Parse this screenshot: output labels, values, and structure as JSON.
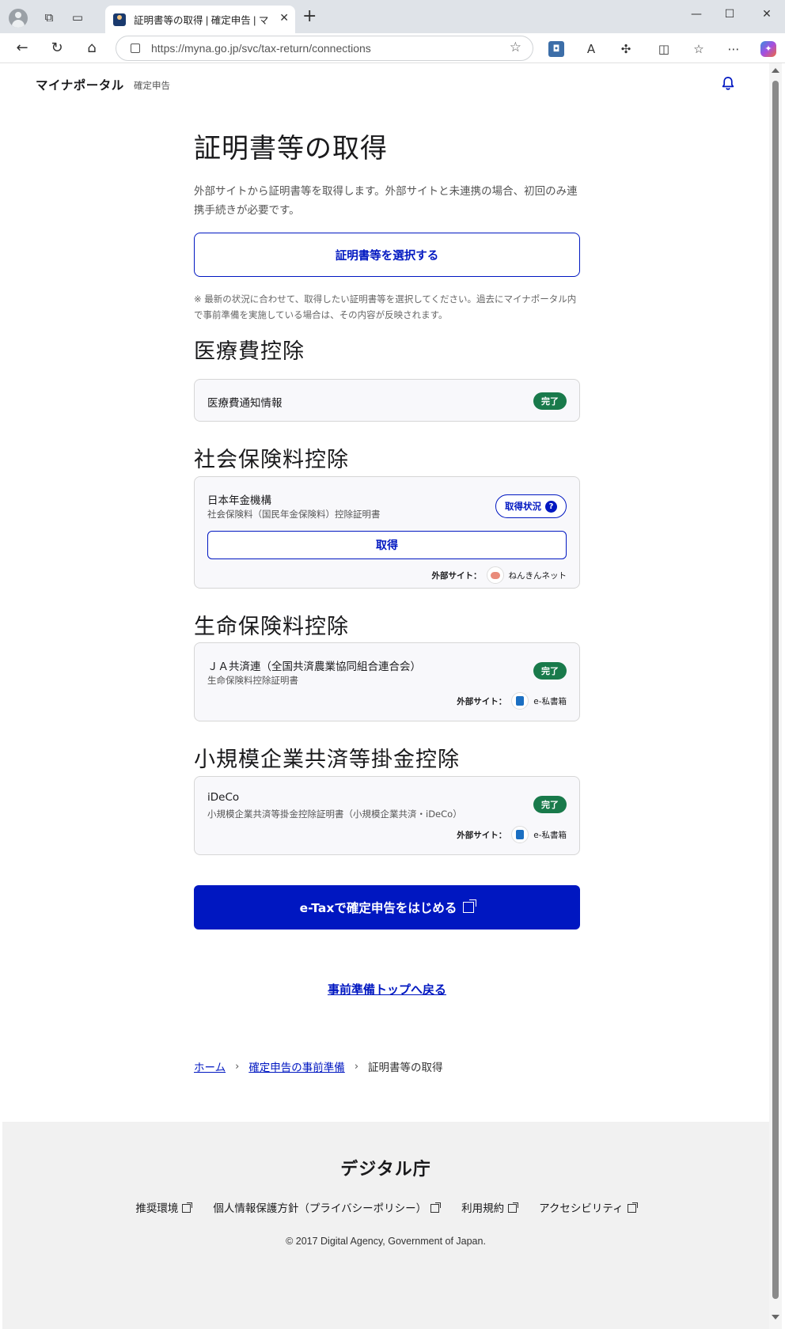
{
  "browser": {
    "tab_title": "証明書等の取得 | 確定申告 | マ",
    "url": "https://myna.go.jp/svc/tax-return/connections"
  },
  "header": {
    "brand": "マイナポータル",
    "sub": "確定申告"
  },
  "page": {
    "title": "証明書等の取得",
    "lead": "外部サイトから証明書等を取得します。外部サイトと未連携の場合、初回のみ連携手続きが必要です。",
    "select_button": "証明書等を選択する",
    "note": "※ 最新の状況に合わせて、取得したい証明書等を選択してください。過去にマイナポータル内で事前準備を実施している場合は、その内容が反映されます。"
  },
  "sections": [
    {
      "heading": "医療費控除",
      "card": {
        "title": "医療費通知情報",
        "badge": "完了"
      }
    },
    {
      "heading": "社会保険料控除",
      "card": {
        "title": "日本年金機構",
        "subtitle": "社会保険料（国民年金保険料）控除証明書",
        "status_button": "取得状況",
        "get_button": "取得",
        "external_label": "外部サイト：",
        "external_site": "ねんきんネット"
      }
    },
    {
      "heading": "生命保険料控除",
      "card": {
        "title": "ＪＡ共済連（全国共済農業協同組合連合会）",
        "subtitle": "生命保険料控除証明書",
        "badge": "完了",
        "external_label": "外部サイト：",
        "external_site": "e-私書箱"
      }
    },
    {
      "heading": "小規模企業共済等掛金控除",
      "card": {
        "title": "iDeCo",
        "subtitle": "小規模企業共済等掛金控除証明書（小規模企業共済・iDeCo）",
        "badge": "完了",
        "external_label": "外部サイト：",
        "external_site": "e-私書箱"
      }
    }
  ],
  "etax_button": "e-Taxで確定申告をはじめる",
  "back_link": "事前準備トップへ戻る",
  "breadcrumb": {
    "home": "ホーム",
    "parent": "確定申告の事前準備",
    "current": "証明書等の取得"
  },
  "footer": {
    "logo": "デジタル庁",
    "links": [
      "推奨環境",
      "個人情報保護方針（プライバシーポリシー）",
      "利用規約",
      "アクセシビリティ"
    ],
    "copyright": "© 2017 Digital Agency, Government of Japan."
  },
  "colors": {
    "primary": "#0017c1",
    "success": "#197a4b"
  }
}
